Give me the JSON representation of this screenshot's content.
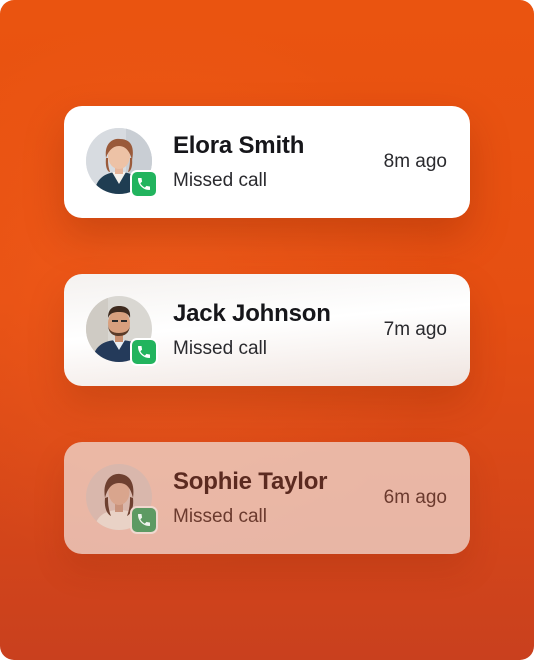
{
  "notifications": [
    {
      "name": "Elora Smith",
      "status": "Missed call",
      "time": "8m ago",
      "avatar_icon": "avatar-elora",
      "badge_icon": "phone-icon",
      "badge_color": "#22b45e"
    },
    {
      "name": "Jack Johnson",
      "status": "Missed call",
      "time": "7m ago",
      "avatar_icon": "avatar-jack",
      "badge_icon": "phone-icon",
      "badge_color": "#22b45e"
    },
    {
      "name": "Sophie Taylor",
      "status": "Missed call",
      "time": "6m ago",
      "avatar_icon": "avatar-sophie",
      "badge_icon": "phone-icon",
      "badge_color": "#5d9a63"
    }
  ],
  "colors": {
    "background": "#e64f12",
    "card": "#ffffff",
    "text": "#16161a"
  }
}
